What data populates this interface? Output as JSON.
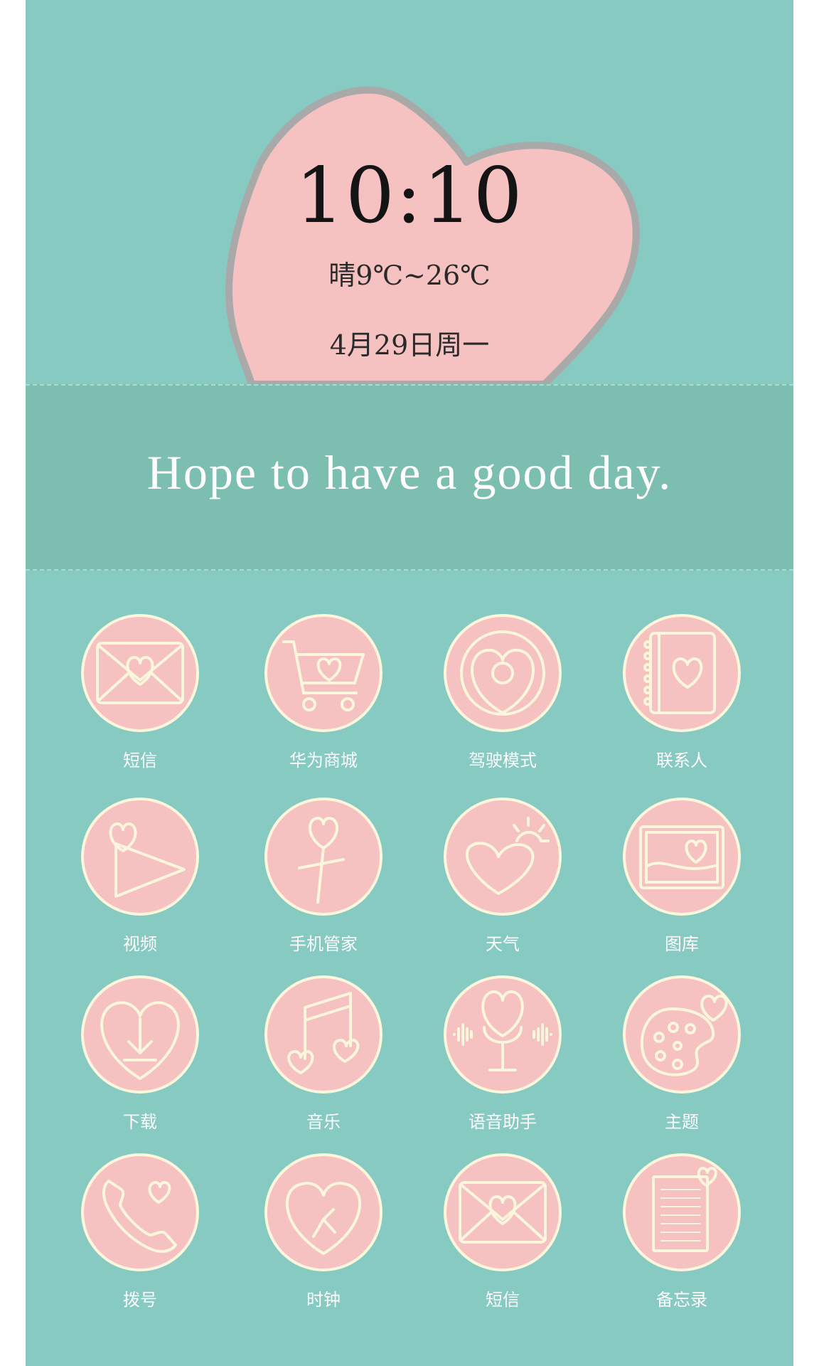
{
  "clock": {
    "time": "10:10",
    "weather": "晴9℃~26℃",
    "date": "4月29日周一"
  },
  "banner": {
    "text": "Hope to have a good day."
  },
  "apps": [
    {
      "label": "短信",
      "icon": "envelope-heart-icon"
    },
    {
      "label": "华为商城",
      "icon": "shopping-cart-heart-icon"
    },
    {
      "label": "驾驶模式",
      "icon": "steering-wheel-heart-icon"
    },
    {
      "label": "联系人",
      "icon": "notebook-heart-icon"
    },
    {
      "label": "视频",
      "icon": "play-heart-icon"
    },
    {
      "label": "手机管家",
      "icon": "heart-flower-icon"
    },
    {
      "label": "天气",
      "icon": "heart-sun-icon"
    },
    {
      "label": "图库",
      "icon": "picture-heart-icon"
    },
    {
      "label": "下载",
      "icon": "heart-download-icon"
    },
    {
      "label": "音乐",
      "icon": "music-note-hearts-icon"
    },
    {
      "label": "语音助手",
      "icon": "microphone-heart-icon"
    },
    {
      "label": "主题",
      "icon": "palette-heart-icon"
    },
    {
      "label": "拨号",
      "icon": "phone-heart-icon"
    },
    {
      "label": "时钟",
      "icon": "heart-clock-icon"
    },
    {
      "label": "短信",
      "icon": "envelope-heart-icon"
    },
    {
      "label": "备忘录",
      "icon": "memo-heart-icon"
    }
  ],
  "colors": {
    "background": "#86cac1",
    "banner": "#7cbfb1",
    "heart": "#f5c1c1",
    "icon_circle": "#f5c1c1",
    "icon_stroke": "#fbf6dc",
    "label": "#ffffff"
  }
}
